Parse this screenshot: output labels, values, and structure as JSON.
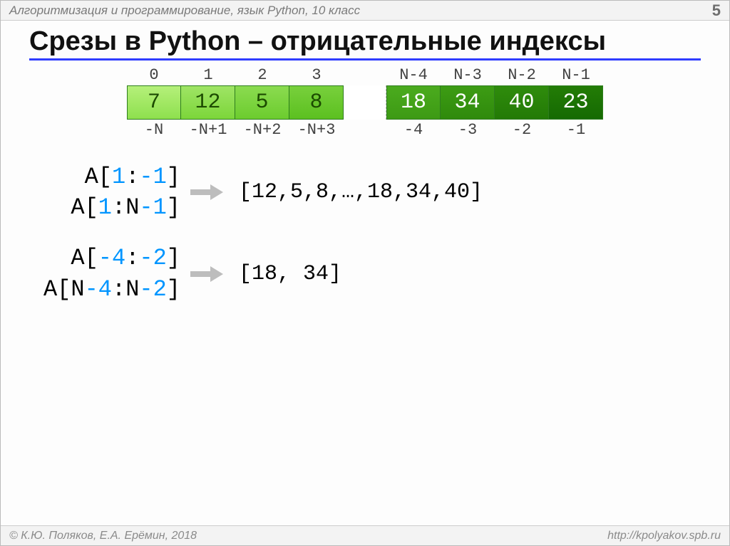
{
  "header": {
    "course": "Алгоритмизация и программирование, язык Python, 10 класс",
    "page": "5"
  },
  "title": "Срезы в Python – отрицательные индексы",
  "array": {
    "top": [
      "0",
      "1",
      "2",
      "3",
      "",
      "N-4",
      "N-3",
      "N-2",
      "N-1"
    ],
    "cells": [
      "7",
      "12",
      "5",
      "8",
      "",
      "18",
      "34",
      "40",
      "23"
    ],
    "bottom": [
      "-N",
      "-N+1",
      "-N+2",
      "-N+3",
      "",
      "-4",
      "-3",
      "-2",
      "-1"
    ]
  },
  "ex1": {
    "line1_a": "A[",
    "line1_b": "1",
    "line1_c": ":",
    "line1_d": "-1",
    "line1_e": "]",
    "line2_a": "A[",
    "line2_b": "1",
    "line2_c": ":N",
    "line2_d": "-1",
    "line2_e": "]",
    "result": "[12,5,8,…,18,34,40]"
  },
  "ex2": {
    "line1_a": "A[",
    "line1_b": "-4",
    "line1_c": ":",
    "line1_d": "-2",
    "line1_e": "]",
    "line2_a": "A[N",
    "line2_b": "-4",
    "line2_c": ":N",
    "line2_d": "-2",
    "line2_e": "]",
    "result": "[18, 34]"
  },
  "footer": {
    "copyright": "© К.Ю. Поляков, Е.А. Ерёмин, 2018",
    "url": "http://kpolyakov.spb.ru"
  }
}
